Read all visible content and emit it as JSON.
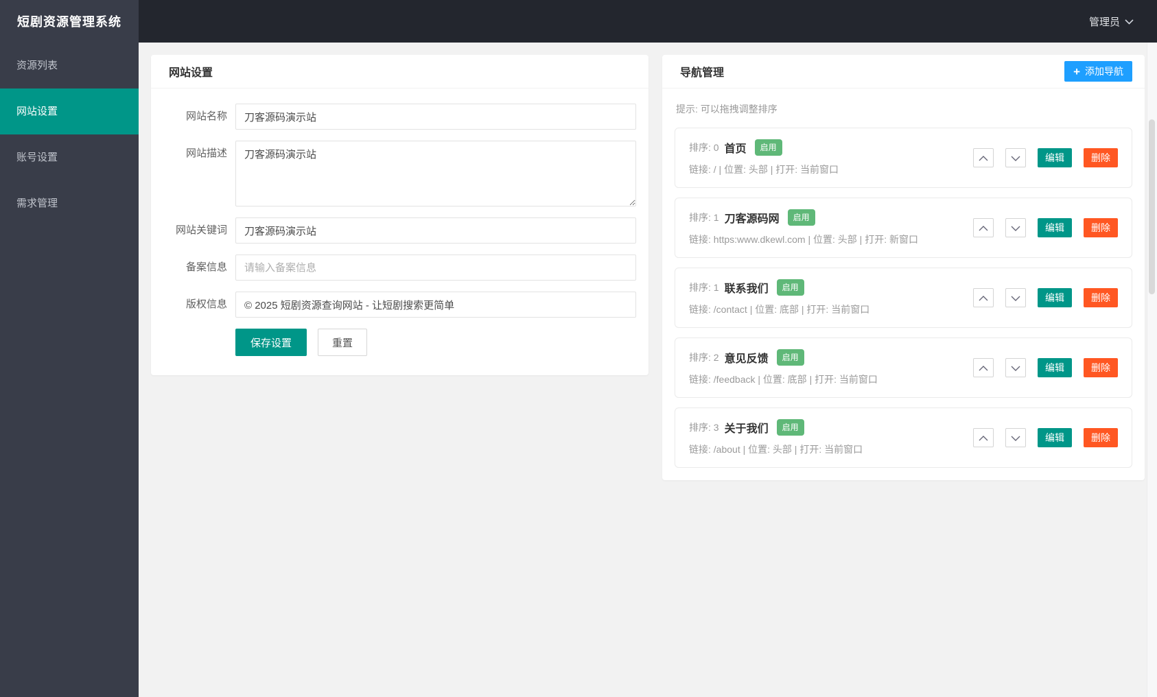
{
  "app": {
    "brand": "短剧资源管理系统",
    "user": "管理员"
  },
  "colors": {
    "topbar": "#23262E",
    "sidebar": "#393D49",
    "accent_teal": "#009688",
    "accent_blue": "#1E9FFF",
    "badge_green": "#5FB878",
    "danger_orange": "#FF5722",
    "page_background": "#f2f2f2"
  },
  "sidebar": {
    "items": [
      {
        "label": "资源列表",
        "active": false
      },
      {
        "label": "网站设置",
        "active": true
      },
      {
        "label": "账号设置",
        "active": false
      },
      {
        "label": "需求管理",
        "active": false
      }
    ]
  },
  "settings_panel": {
    "title": "网站设置",
    "fields": {
      "site_name": {
        "label": "网站名称",
        "value": "刀客源码演示站"
      },
      "site_description": {
        "label": "网站描述",
        "value": "刀客源码演示站"
      },
      "site_keywords": {
        "label": "网站关键词",
        "value": "刀客源码演示站"
      },
      "icp": {
        "label": "备案信息",
        "placeholder": "请输入备案信息"
      },
      "copyright": {
        "label": "版权信息",
        "value": "© 2025 短剧资源查询网站 - 让短剧搜索更简单"
      }
    },
    "save_label": "保存设置",
    "reset_label": "重置"
  },
  "nav_panel": {
    "title": "导航管理",
    "add_label": "添加导航",
    "hint": "提示: 可以拖拽调整排序",
    "edit_label": "编辑",
    "delete_label": "删除",
    "items": [
      {
        "sort_label": "排序: 0",
        "name": "首页",
        "status": "启用",
        "meta": "链接: / | 位置: 头部 | 打开: 当前窗口"
      },
      {
        "sort_label": "排序: 1",
        "name": "刀客源码网",
        "status": "启用",
        "meta": "链接: https:www.dkewl.com | 位置: 头部 | 打开: 新窗口"
      },
      {
        "sort_label": "排序: 1",
        "name": "联系我们",
        "status": "启用",
        "meta": "链接: /contact | 位置: 底部 | 打开: 当前窗口"
      },
      {
        "sort_label": "排序: 2",
        "name": "意见反馈",
        "status": "启用",
        "meta": "链接: /feedback | 位置: 底部 | 打开: 当前窗口"
      },
      {
        "sort_label": "排序: 3",
        "name": "关于我们",
        "status": "启用",
        "meta": "链接: /about | 位置: 头部 | 打开: 当前窗口"
      }
    ]
  }
}
